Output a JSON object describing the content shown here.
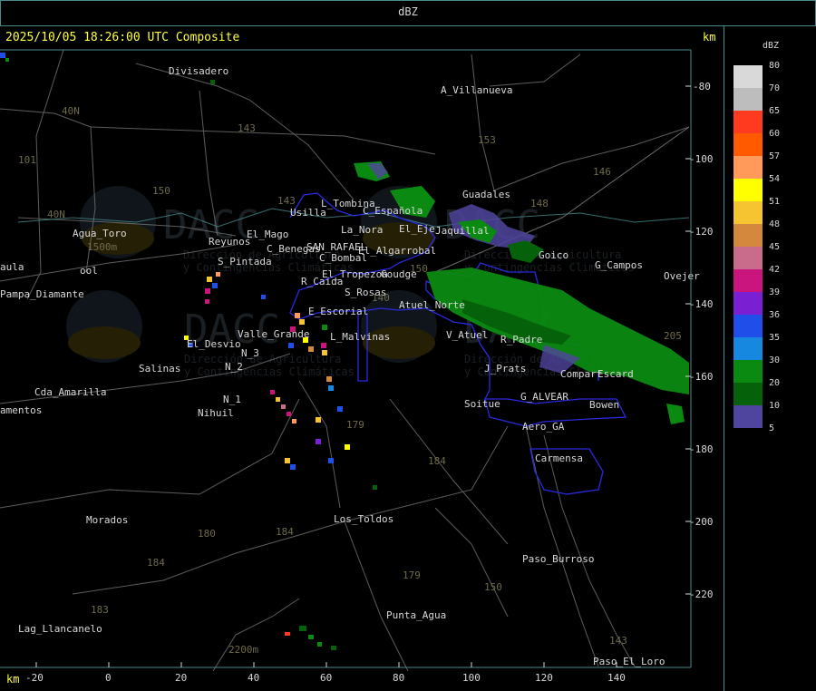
{
  "header": {
    "title": "dBZ"
  },
  "timestamp": "2025/10/05 18:26:00 UTC Composite",
  "axis_unit": "km",
  "x_axis_ticks": [
    "-20",
    "0",
    "20",
    "40",
    "60",
    "80",
    "100",
    "120",
    "140"
  ],
  "y_axis_ticks": [
    "-80",
    "-100",
    "-120",
    "-140",
    "-160",
    "-180",
    "-200",
    "-220"
  ],
  "legend": {
    "title": "dBZ",
    "entries": [
      {
        "label": "80",
        "color": "#d9d9d9"
      },
      {
        "label": "70",
        "color": "#bdbdbd"
      },
      {
        "label": "65",
        "color": "#ff3a1f"
      },
      {
        "label": "60",
        "color": "#ff5a00"
      },
      {
        "label": "57",
        "color": "#ff9a5a"
      },
      {
        "label": "54",
        "color": "#ffff00"
      },
      {
        "label": "51",
        "color": "#f7c431"
      },
      {
        "label": "48",
        "color": "#d4883e"
      },
      {
        "label": "45",
        "color": "#c96b8a"
      },
      {
        "label": "42",
        "color": "#c9157d"
      },
      {
        "label": "39",
        "color": "#7a1fd1"
      },
      {
        "label": "36",
        "color": "#1f4fe8"
      },
      {
        "label": "35",
        "color": "#1688df"
      },
      {
        "label": "30",
        "color": "#0b8a11"
      },
      {
        "label": "20",
        "color": "#06620a"
      },
      {
        "label": "10",
        "color": "#50459e"
      },
      {
        "label": "5",
        "color": ""
      }
    ]
  },
  "place_labels": [
    "Divisadero",
    "A_Villanueva",
    "Guadales",
    "L_Tombina",
    "C_Española",
    "Usilla",
    "La_Nora",
    "El_Eje",
    "Jaquillal",
    "Reyunos",
    "El_Mago",
    "C_Benegas",
    "SAN_RAFAEL",
    "El_Algarrobal",
    "C_Bombal",
    "S_Pintada",
    "El_Tropezon",
    "Goudge",
    "R_Caida",
    "S_Rosas",
    "Atuel_Norte",
    "E_Escorial",
    "Valle_Grande",
    "L_Malvinas",
    "V_Atuel",
    "R_Padre",
    "El_Desvio",
    "Salinas",
    "N_3",
    "N_2",
    "N_1",
    "Nihuil",
    "J_Prats",
    "Compart",
    "Escard",
    "G_ALVEAR",
    "Bowen",
    "Soitue",
    "Aero_GA",
    "Carmensa",
    "Cda_Amarilla",
    "amentos",
    "Morados",
    "Los_Toldos",
    "Paso_Burroso",
    "Punta_Agua",
    "Lag_Llancanelo",
    "Paso_El_Loro",
    "Agua_Toro",
    "Pampa_Diamante",
    "aula",
    "G_Campos",
    "Ovejer",
    "Goico",
    "ool"
  ],
  "contour_labels": [
    "101",
    "40N",
    "143",
    "153",
    "146",
    "150",
    "148",
    "40N",
    "140",
    "143",
    "150",
    "205",
    "179",
    "184",
    "180",
    "184",
    "179",
    "150",
    "183",
    "184",
    "143",
    "2200m",
    "1500m"
  ],
  "watermark": {
    "brand": "DACC",
    "line1": "Dirección de Agricultura",
    "line2": "y Contingencias Climáticas"
  },
  "colors": {
    "frame": "#4c8a8c",
    "timestamp": "#ffff40",
    "roads": "#8a8a8a",
    "districts": "#2a2ae0"
  }
}
